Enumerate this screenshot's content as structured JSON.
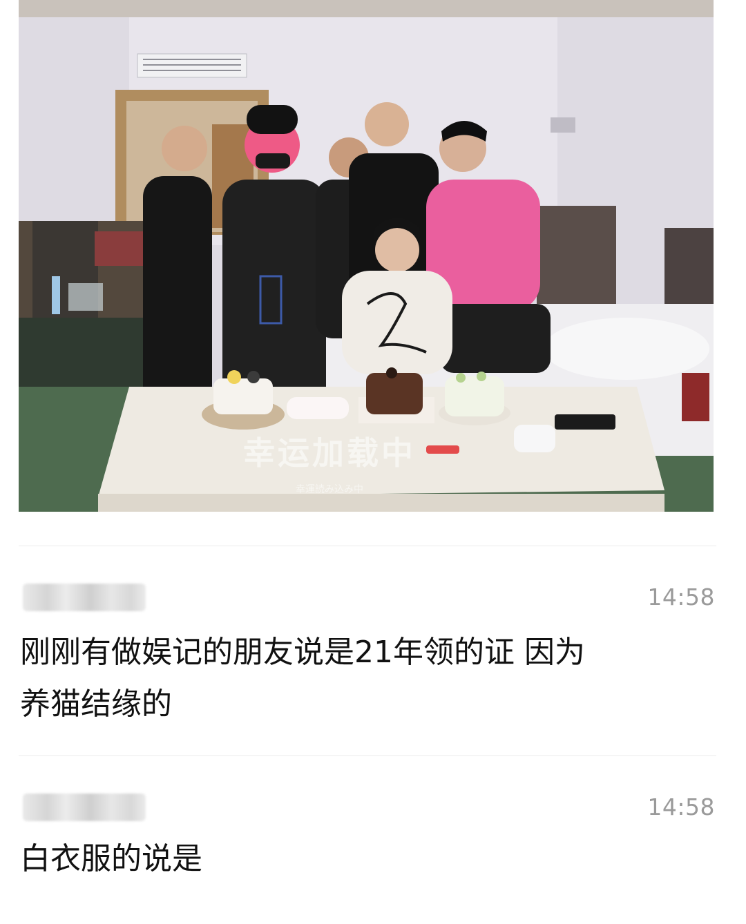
{
  "photo": {
    "overlay_title": "幸运加载中",
    "overlay_subtitle": "幸運読み込み中"
  },
  "comments": [
    {
      "time": "14:58",
      "text_line1": "刚刚有做娱记的朋友说是21年领的证  因为",
      "text_line2": "养猫结缘的"
    },
    {
      "time": "14:58",
      "text_line1": "白衣服的说是"
    }
  ],
  "colors": {
    "divider": "#ececec",
    "timestamp": "#9a9a9a",
    "text": "#111111"
  }
}
